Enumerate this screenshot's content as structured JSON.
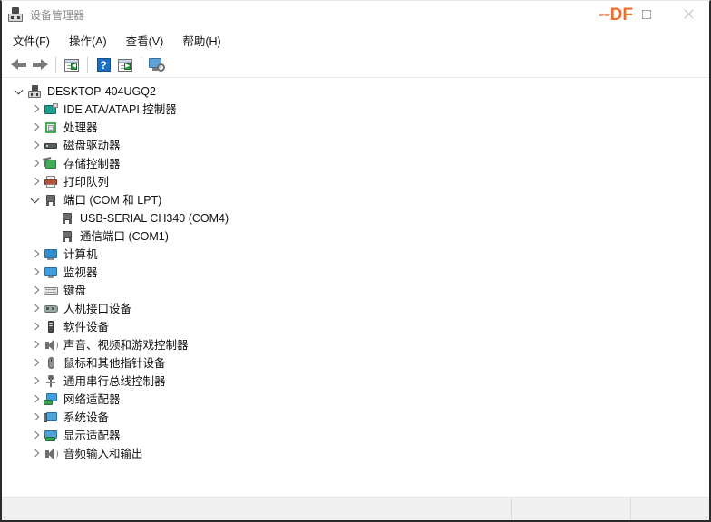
{
  "window": {
    "title": "设备管理器",
    "icon": "device-manager-icon",
    "watermark": "DF",
    "watermark_color": "#ef6c2a",
    "controls": {
      "minimize": "最小化",
      "maximize": "最大化",
      "close": "关闭"
    }
  },
  "menubar": {
    "items": [
      {
        "label": "文件(F)",
        "name": "menu-file"
      },
      {
        "label": "操作(A)",
        "name": "menu-action"
      },
      {
        "label": "查看(V)",
        "name": "menu-view"
      },
      {
        "label": "帮助(H)",
        "name": "menu-help"
      }
    ]
  },
  "toolbar": {
    "buttons": [
      {
        "icon": "back-arrow-icon",
        "label": "后退"
      },
      {
        "icon": "forward-arrow-icon",
        "label": "前进"
      },
      {
        "icon": "properties-icon",
        "label": "属性"
      },
      {
        "icon": "help-icon",
        "label": "帮助",
        "glyph": "?"
      },
      {
        "icon": "update-driver-icon",
        "label": "更新驱动程序"
      },
      {
        "icon": "scan-hardware-icon",
        "label": "扫描检测硬件改动"
      }
    ]
  },
  "tree": {
    "root": {
      "label": "DESKTOP-404UGQ2",
      "icon": "computer-root-icon",
      "expanded": true
    },
    "nodes": [
      {
        "label": "IDE ATA/ATAPI 控制器",
        "icon": "ide-controller-icon",
        "expanded": false,
        "depth": 1
      },
      {
        "label": "处理器",
        "icon": "processor-icon",
        "expanded": false,
        "depth": 1
      },
      {
        "label": "磁盘驱动器",
        "icon": "disk-drive-icon",
        "expanded": false,
        "depth": 1
      },
      {
        "label": "存储控制器",
        "icon": "storage-controller-icon",
        "expanded": false,
        "depth": 1
      },
      {
        "label": "打印队列",
        "icon": "print-queue-icon",
        "expanded": false,
        "depth": 1
      },
      {
        "label": "端口 (COM 和 LPT)",
        "icon": "ports-icon",
        "expanded": true,
        "depth": 1
      },
      {
        "label": "USB-SERIAL CH340 (COM4)",
        "icon": "port-icon",
        "expanded": null,
        "depth": 2
      },
      {
        "label": "通信端口 (COM1)",
        "icon": "port-icon",
        "expanded": null,
        "depth": 2
      },
      {
        "label": "计算机",
        "icon": "computer-icon",
        "expanded": false,
        "depth": 1
      },
      {
        "label": "监视器",
        "icon": "monitor-icon",
        "expanded": false,
        "depth": 1
      },
      {
        "label": "键盘",
        "icon": "keyboard-icon",
        "expanded": false,
        "depth": 1
      },
      {
        "label": "人机接口设备",
        "icon": "hid-icon",
        "expanded": false,
        "depth": 1
      },
      {
        "label": "软件设备",
        "icon": "software-device-icon",
        "expanded": false,
        "depth": 1
      },
      {
        "label": "声音、视频和游戏控制器",
        "icon": "sound-video-game-icon",
        "expanded": false,
        "depth": 1
      },
      {
        "label": "鼠标和其他指针设备",
        "icon": "mouse-icon",
        "expanded": false,
        "depth": 1
      },
      {
        "label": "通用串行总线控制器",
        "icon": "usb-controller-icon",
        "expanded": false,
        "depth": 1
      },
      {
        "label": "网络适配器",
        "icon": "network-adapter-icon",
        "expanded": false,
        "depth": 1
      },
      {
        "label": "系统设备",
        "icon": "system-device-icon",
        "expanded": false,
        "depth": 1
      },
      {
        "label": "显示适配器",
        "icon": "display-adapter-icon",
        "expanded": false,
        "depth": 1
      },
      {
        "label": "音频输入和输出",
        "icon": "audio-io-icon",
        "expanded": false,
        "depth": 1
      }
    ]
  },
  "statusbar": {
    "panes": [
      {
        "text": "",
        "name": "status-message"
      },
      {
        "text": "",
        "name": "status-secondary"
      },
      {
        "text": "",
        "name": "status-tertiary"
      }
    ]
  }
}
